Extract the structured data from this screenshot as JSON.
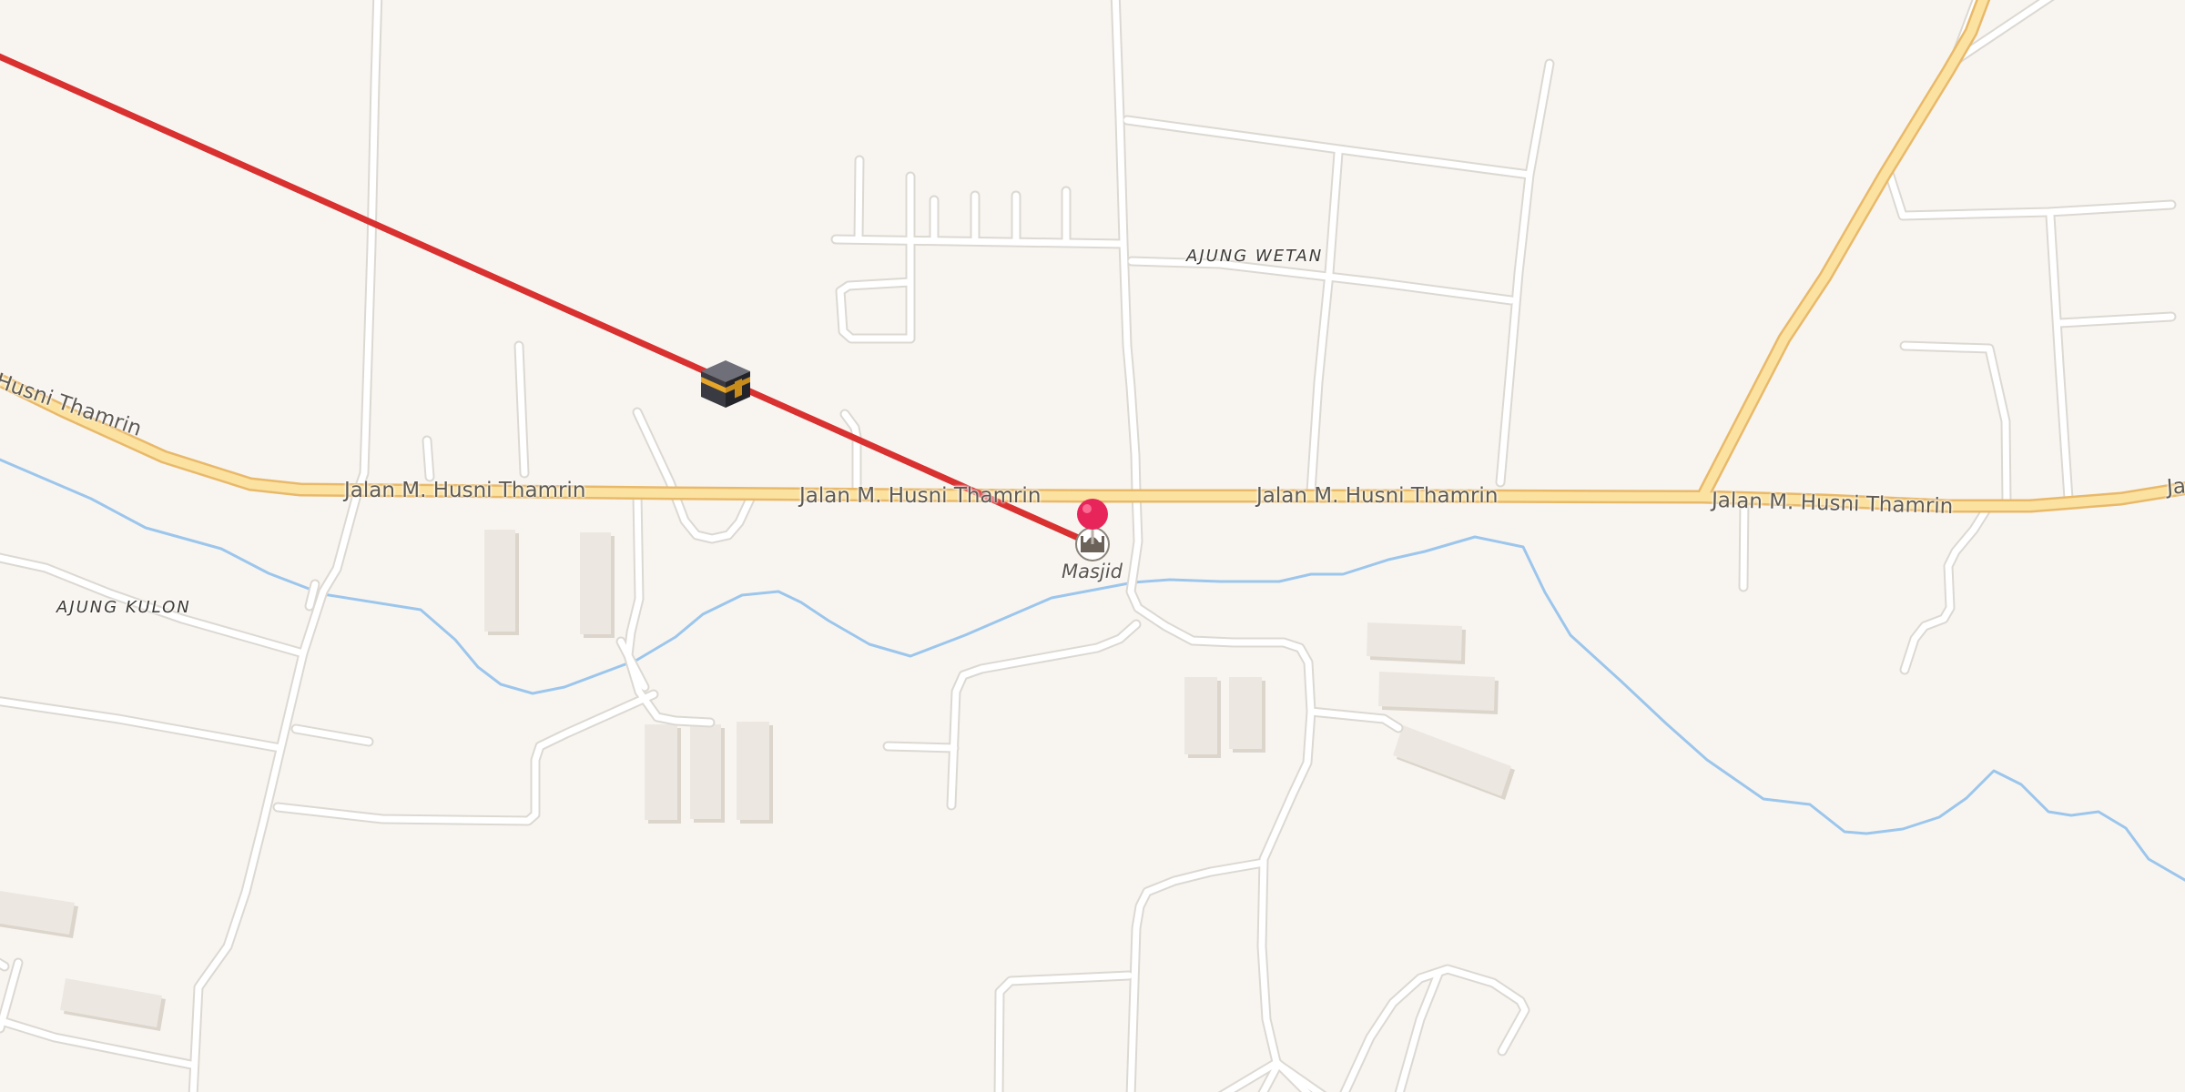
{
  "map": {
    "background_color": "#f8f5f1",
    "colors": {
      "minor_road": "#ffffff",
      "minor_road_casing": "#dcd8d2",
      "primary_road": "#fbe2a0",
      "primary_road_casing": "#e9b96a",
      "waterway": "#9cc6ec",
      "building": "#ece7e1",
      "qibla_line": "#d93030",
      "pin": "#e8255a"
    },
    "road_labels": [
      "Husni Thamrin",
      "Jalan M. Husni Thamrin",
      "Jalan M. Husni Thamrin",
      "Jalan M. Husni Thamrin",
      "Jalan M. Husni Thamrin",
      "Ja"
    ],
    "area_labels": [
      "AJUNG WETAN",
      "AJUNG KULON"
    ],
    "poi": {
      "label": "Masjid",
      "icon": "mosque-icon"
    },
    "markers": {
      "kaaba": "kaaba-icon",
      "location": "location-pin-icon"
    },
    "overlays": {
      "qibla_direction_line": "qibla-line"
    }
  }
}
